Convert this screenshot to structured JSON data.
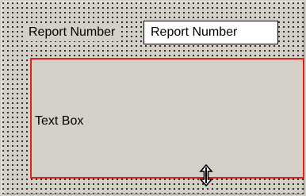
{
  "form": {
    "report_number_label": "Report Number",
    "report_number_field": "Report Number",
    "text_box_label": "Text Box"
  },
  "icons": {
    "resize_cursor": "vertical-resize-cursor-icon"
  },
  "colors": {
    "design_surface": "#d4d0c8",
    "selection_border": "#e0201c",
    "grid_dot": "#000000",
    "field_background": "#ffffff"
  }
}
